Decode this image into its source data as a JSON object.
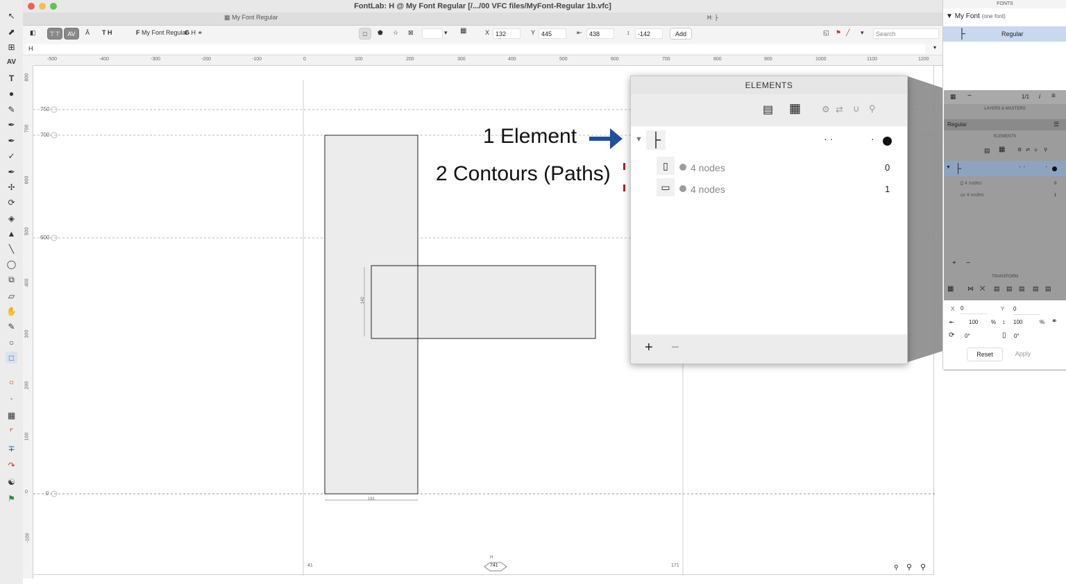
{
  "window": {
    "title": "FontLab: H @ My Font Regular [/.../00 VFC files/MyFont-Regular 1b.vfc]"
  },
  "tab": {
    "label": "My Font Regular",
    "glyph_indicator": "H:"
  },
  "toolbar": {
    "font_label": "My Font Regular",
    "glyph_label": "H",
    "x_label": "X",
    "x_value": "132",
    "y_label": "Y",
    "y_value": "445",
    "w_value": "438",
    "h_value": "-142",
    "add_label": "Add",
    "search_placeholder": "Search",
    "av_label": "AV",
    "th_label": "T H"
  },
  "text_bar": {
    "value": "H"
  },
  "rulers": {
    "top": [
      "-500",
      "-400",
      "-300",
      "-200",
      "-100",
      "0",
      "100",
      "200",
      "300",
      "400",
      "500",
      "600",
      "700",
      "800",
      "900",
      "1000",
      "1100",
      "1200"
    ],
    "left": [
      "800",
      "700",
      "600",
      "500",
      "400",
      "300",
      "200",
      "100",
      "0",
      "-100"
    ]
  },
  "canvas": {
    "guides": [
      "750",
      "700",
      "600",
      "0"
    ],
    "height_dim": "142",
    "width_dim": "181",
    "lsb": "41",
    "advance": "741",
    "rsb": "171",
    "glyph_name": "H"
  },
  "annotations": {
    "element": "1 Element",
    "contours": "2 Contours (Paths)"
  },
  "elements_panel": {
    "title": "ELEMENTS",
    "contours": [
      {
        "label": "4 nodes",
        "index": "0"
      },
      {
        "label": "4 nodes",
        "index": "1"
      }
    ],
    "add": "+",
    "remove": "−"
  },
  "fonts_panel": {
    "header": "FONTS",
    "font_name": "My Font",
    "font_note": "(one font)",
    "master": "Regular",
    "count": "1/1",
    "layers_header": "LAYERS & MASTERS",
    "layer": "Regular",
    "elements_header": "ELEMENTS",
    "nodes": [
      "4 nodes",
      "4 nodes"
    ],
    "indices": [
      "0",
      "1"
    ],
    "transform_header": "TRANSFORM",
    "x": "0",
    "y": "0",
    "w": "100",
    "h": "100",
    "pct": "%",
    "angle1": "0°",
    "angle2": "0°",
    "reset": "Reset",
    "apply": "Apply"
  },
  "colors": {
    "accent_blue": "#1f4e9c",
    "accent_red": "#b01c2e",
    "selection": "#c7d8ef"
  }
}
